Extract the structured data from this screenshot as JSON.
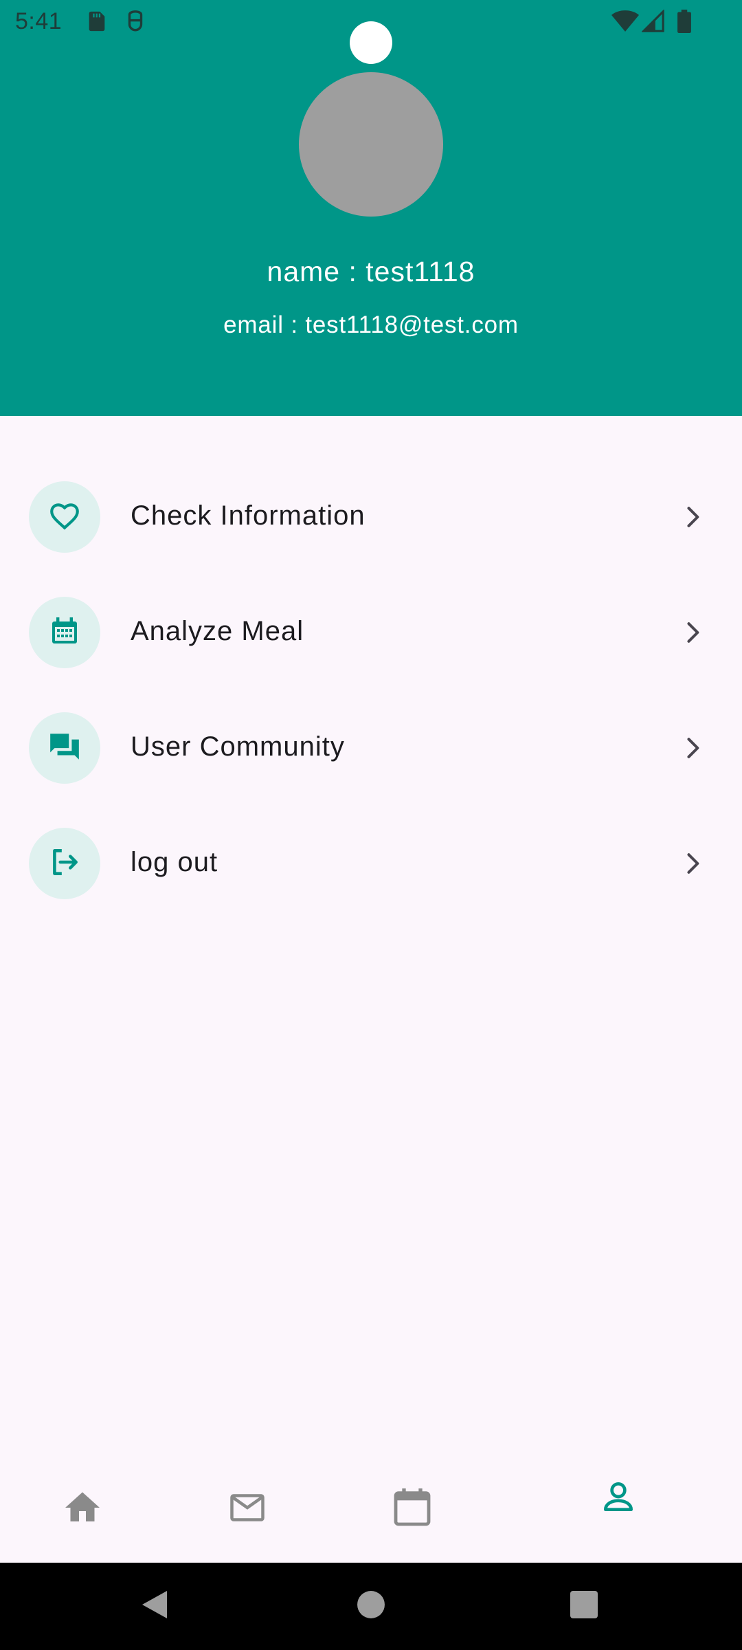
{
  "status_bar": {
    "time": "5:41",
    "icons": [
      "sd-card-icon",
      "accessibility-icon",
      "wifi-icon",
      "signal-icon",
      "battery-icon"
    ]
  },
  "profile": {
    "name_line": "name : test1118",
    "email_line": "email : test1118@test.com"
  },
  "menu": {
    "items": [
      {
        "label": "Check Information",
        "icon": "heart-icon"
      },
      {
        "label": "Analyze Meal",
        "icon": "calendar-grid-icon"
      },
      {
        "label": "User Community",
        "icon": "forum-icon"
      },
      {
        "label": "log out",
        "icon": "logout-icon"
      }
    ]
  },
  "bottom_nav": {
    "items": [
      "home-icon",
      "mail-icon",
      "calendar-icon",
      "person-icon"
    ],
    "active": "person-icon"
  },
  "colors": {
    "primary": "#009688",
    "background": "#fcf6fc",
    "icon_circle": "#dff1ef",
    "inactive_nav": "#8a8a8a"
  }
}
